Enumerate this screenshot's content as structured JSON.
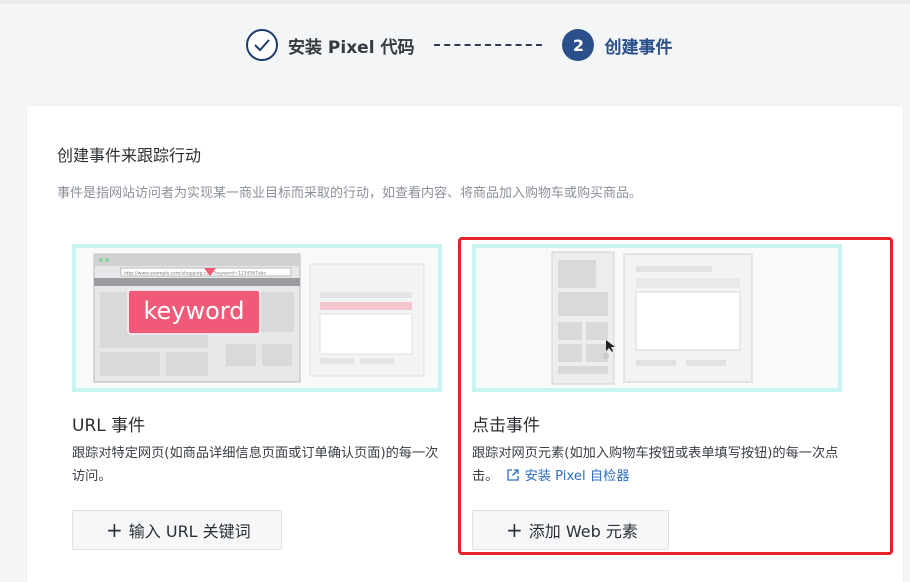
{
  "stepper": {
    "step1_label": "安装 Pixel 代码",
    "step2_number": "2",
    "step2_label": "创建事件"
  },
  "card": {
    "title": "创建事件来跟踪行动",
    "description": "事件是指网站访问者为实现某一商业目标而采取的行动，如查看内容、将商品加入购物车或购买商品。"
  },
  "url_event": {
    "illustration_keyword": "keyword",
    "illustration_url_text": "http://www.example.com/shopping-cart?keyword=1234567abc",
    "title": "URL 事件",
    "description": "跟踪对特定网页(如商品详细信息页面或订单确认页面)的每一次访问。",
    "button_label": "输入 URL 关键词"
  },
  "click_event": {
    "title": "点击事件",
    "description": "跟踪对网页元素(如加入购物车按钮或表单填写按钮)的每一次点击。",
    "link_label": "安装 Pixel 自检器",
    "button_label": "添加 Web 元素"
  },
  "colors": {
    "accent": "#2a4f8a",
    "link": "#2f6fbf",
    "highlight": "#e3242b",
    "illus_border": "#c9f4f1",
    "keyword_tag": "#f05a78"
  },
  "icons": [
    "check-icon",
    "plus-icon",
    "external-link-icon",
    "cursor-icon"
  ]
}
